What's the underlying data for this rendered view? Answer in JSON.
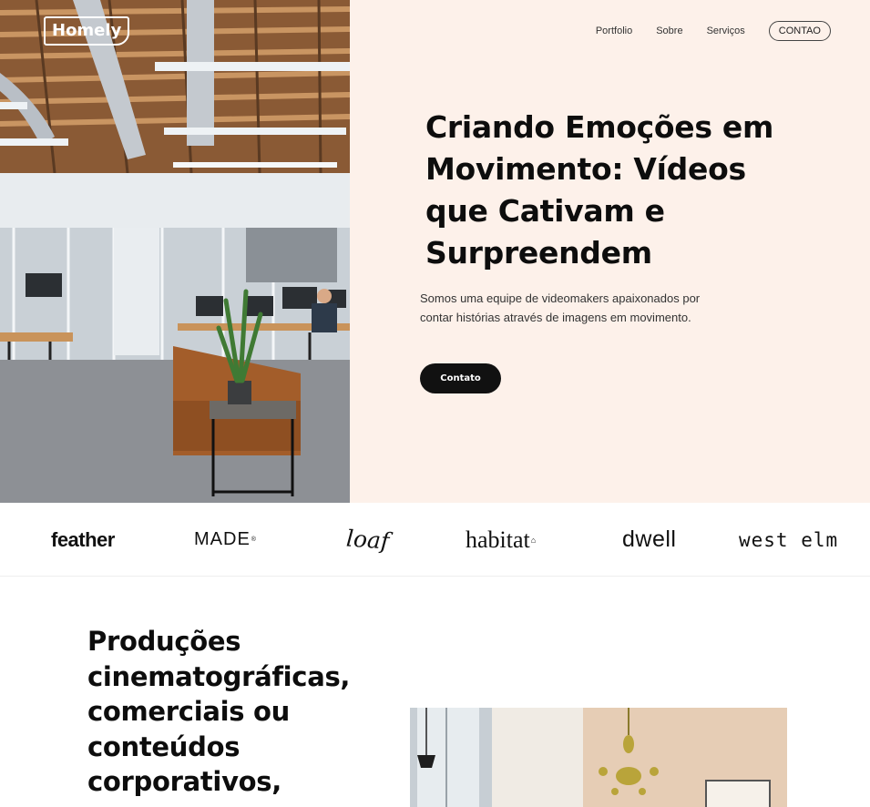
{
  "brand": {
    "logo_text": "Homely"
  },
  "nav": {
    "items": [
      {
        "label": "Portfolio"
      },
      {
        "label": "Sobre"
      },
      {
        "label": "Serviços"
      }
    ],
    "cta_label": "CONTAO"
  },
  "hero": {
    "title": "Criando Emoções em Movimento: Vídeos que Cativam e Surpreendem",
    "subtitle": "Somos uma equipe de videomakers apaixonados por contar histórias através de imagens em movimento.",
    "button_label": "Contato",
    "panel_color": "#fdf1ea"
  },
  "brands": {
    "feather": "feather",
    "made": "MADE",
    "made_mark": "®",
    "loaf": "loaf",
    "habitat": "habitat",
    "dwell": "dwell",
    "westelm": "west elm"
  },
  "section2": {
    "title": "Produções cinematográficas, comerciais ou conteúdos corporativos,"
  },
  "icons": {
    "office_photo": "office-photo",
    "interior_photo": "interior-photo"
  }
}
